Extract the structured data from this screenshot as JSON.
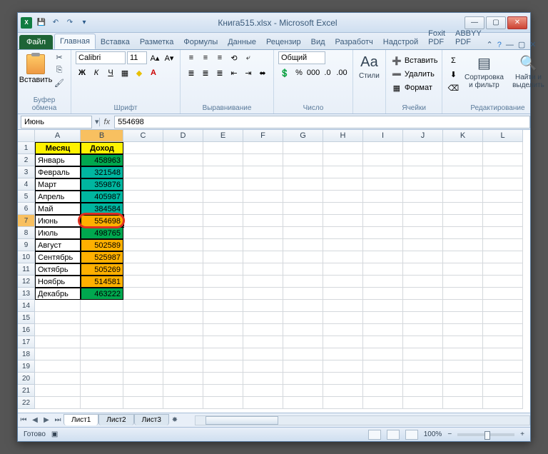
{
  "window": {
    "filename": "Книга515.xlsx",
    "app": "Microsoft Excel"
  },
  "qat": {
    "save": "💾",
    "undo": "↶",
    "redo": "↷"
  },
  "tabs": {
    "file": "Файл",
    "items": [
      "Главная",
      "Вставка",
      "Разметка",
      "Формулы",
      "Данные",
      "Рецензир",
      "Вид",
      "Разработч",
      "Надстрой",
      "Foxit PDF",
      "ABBYY PDF"
    ],
    "active": 0
  },
  "ribbon": {
    "clipboard": {
      "paste": "Вставить",
      "label": "Буфер обмена"
    },
    "font": {
      "name": "Calibri",
      "size": "11",
      "label": "Шрифт"
    },
    "align": {
      "label": "Выравнивание"
    },
    "number": {
      "format": "Общий",
      "label": "Число"
    },
    "styles": {
      "btn": "Стили",
      "label": ""
    },
    "cells": {
      "insert": "Вставить",
      "delete": "Удалить",
      "format": "Формат",
      "label": "Ячейки"
    },
    "edit": {
      "sort": "Сортировка и фильтр",
      "find": "Найти и выделить",
      "label": "Редактирование"
    }
  },
  "namebox": "Июнь",
  "formula": "554698",
  "columns": [
    "A",
    "B",
    "C",
    "D",
    "E",
    "F",
    "G",
    "H",
    "I",
    "J",
    "K",
    "L"
  ],
  "headers": {
    "a": "Месяц",
    "b": "Доход"
  },
  "rows": [
    {
      "month": "Январь",
      "value": "458963",
      "cls": "lv1"
    },
    {
      "month": "Февраль",
      "value": "321548",
      "cls": "lv2"
    },
    {
      "month": "Март",
      "value": "359876",
      "cls": "lv2"
    },
    {
      "month": "Апрель",
      "value": "405987",
      "cls": "lv2"
    },
    {
      "month": "Май",
      "value": "384584",
      "cls": "lv2"
    },
    {
      "month": "Июнь",
      "value": "554698",
      "cls": "lv3",
      "active": true
    },
    {
      "month": "Июль",
      "value": "498765",
      "cls": "lv1"
    },
    {
      "month": "Август",
      "value": "502589",
      "cls": "lv3"
    },
    {
      "month": "Сентябрь",
      "value": "525987",
      "cls": "lv3"
    },
    {
      "month": "Октябрь",
      "value": "505269",
      "cls": "lv3"
    },
    {
      "month": "Ноябрь",
      "value": "514581",
      "cls": "lv3"
    },
    {
      "month": "Декабрь",
      "value": "463222",
      "cls": "lv1"
    }
  ],
  "empty_rows": 9,
  "sheets": [
    "Лист1",
    "Лист2",
    "Лист3"
  ],
  "status": {
    "ready": "Готово",
    "zoom": "100%"
  }
}
